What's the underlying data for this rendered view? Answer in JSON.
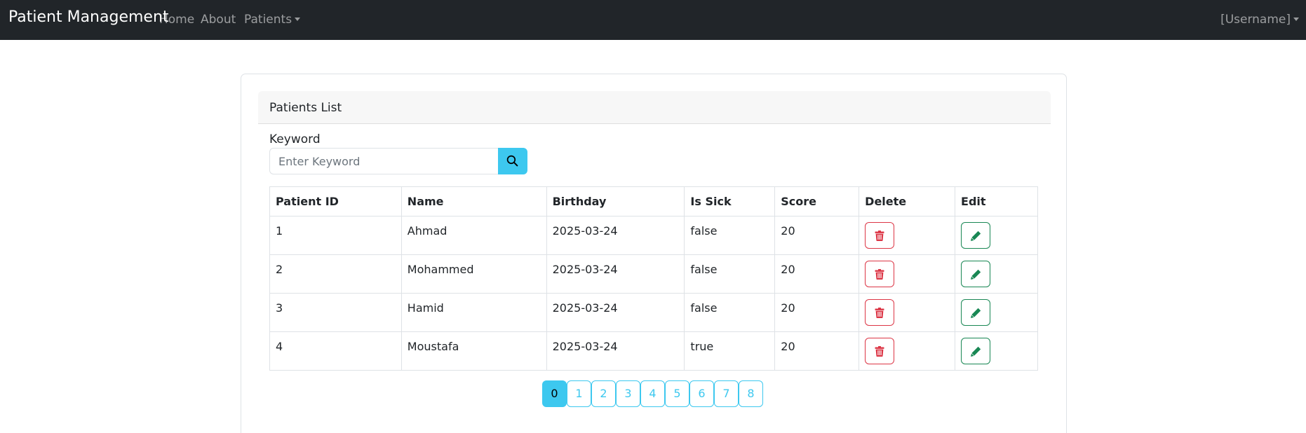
{
  "navbar": {
    "brand": "Patient Management",
    "links": [
      "Home",
      "About",
      "Patients"
    ],
    "user": "[Username]"
  },
  "card": {
    "title": "Patients List",
    "keyword_label": "Keyword",
    "keyword_placeholder": "Enter Keyword",
    "search_icon": "search-icon"
  },
  "table": {
    "headers": [
      "Patient ID",
      "Name",
      "Birthday",
      "Is Sick",
      "Score",
      "Delete",
      "Edit"
    ],
    "rows": [
      [
        "1",
        "Ahmad",
        "2025-03-24",
        "false",
        "20"
      ],
      [
        "2",
        "Mohammed",
        "2025-03-24",
        "false",
        "20"
      ],
      [
        "3",
        "Hamid",
        "2025-03-24",
        "false",
        "20"
      ],
      [
        "4",
        "Moustafa",
        "2025-03-24",
        "true",
        "20"
      ]
    ],
    "delete_icon": "trash-icon",
    "edit_icon": "pencil-icon"
  },
  "pagination": {
    "pages": [
      "0",
      "1",
      "2",
      "3",
      "4",
      "5",
      "6",
      "7",
      "8"
    ],
    "active": "0"
  },
  "colors": {
    "navbar_bg": "#212529",
    "info": "#3dc8ef",
    "danger": "#dc3545",
    "success": "#198754"
  }
}
